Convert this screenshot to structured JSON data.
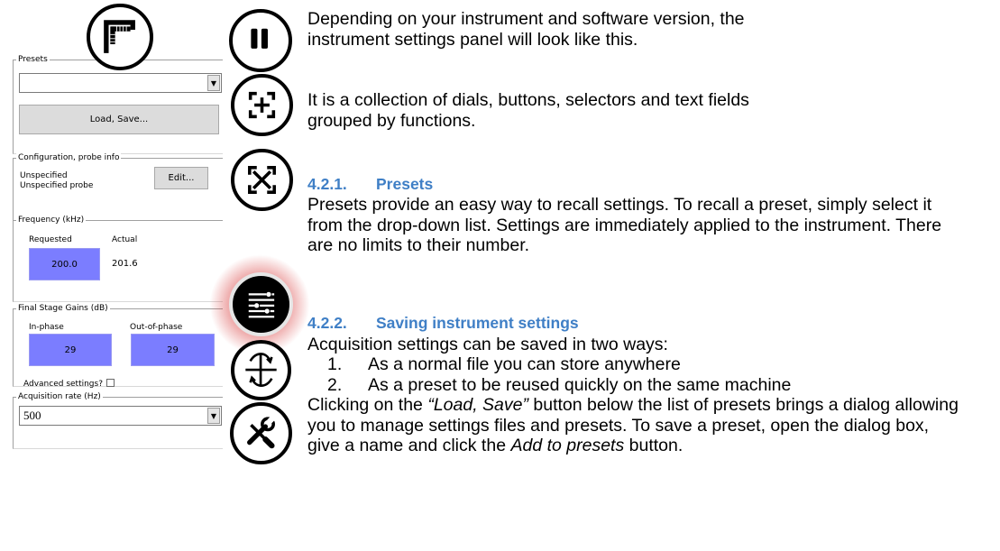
{
  "panel": {
    "presets": {
      "legend": "Presets",
      "selected_value": "",
      "load_save_label": "Load, Save..."
    },
    "configuration": {
      "legend": "Configuration, probe info",
      "line1": "Unspecified",
      "line2": "Unspecified probe",
      "edit_label": "Edit..."
    },
    "frequency": {
      "legend": "Frequency (kHz)",
      "requested_label": "Requested",
      "actual_label": "Actual",
      "requested_value": "200.0",
      "actual_value": "201.6"
    },
    "gains": {
      "legend": "Final Stage Gains (dB)",
      "in_phase_label": "In-phase",
      "out_phase_label": "Out-of-phase",
      "in_phase_value": "29",
      "out_phase_value": "29"
    },
    "advanced_label": "Advanced settings?",
    "advanced_checked": false,
    "acquisition": {
      "legend": "Acquisition rate (Hz)",
      "selected_value": "500"
    }
  },
  "icons": [
    "ruler-icon",
    "pause-icon",
    "zoom-fit-icon",
    "fullscreen-icon",
    "settings-sliders-icon",
    "flip-signal-icon",
    "tools-icon"
  ],
  "colors": {
    "heading": "#3f7fc6",
    "value_box": "#7b7dff",
    "highlight_glow": "#d73737"
  },
  "text": {
    "intro1": "Depending on your instrument and software version, the instrument settings panel will look like this.",
    "intro2": "It is a collection of dials, buttons, selectors and text fields grouped by functions.",
    "h1_num": "4.2.1.",
    "h1_title": "Presets",
    "p1": "Presets provide an easy way to recall settings. To recall a preset, simply select it from the drop-down list. Settings are immediately applied to the instrument. There are no limits to their number.",
    "h2_num": "4.2.2.",
    "h2_title": "Saving instrument settings",
    "p2": "Acquisition settings can be saved in two ways:",
    "list": [
      {
        "n": "1.",
        "t": "As a normal file you can store anywhere"
      },
      {
        "n": "2.",
        "t": "As a preset to be reused quickly on the same machine"
      }
    ],
    "p3_a": "Clicking on the ",
    "p3_quote": "“Load, Save”",
    "p3_b": " button below the list of presets brings a dialog allowing you to manage settings files and presets. To save a preset, open the dialog box, give a name and click the ",
    "p3_em": "Add to presets",
    "p3_c": " button."
  }
}
